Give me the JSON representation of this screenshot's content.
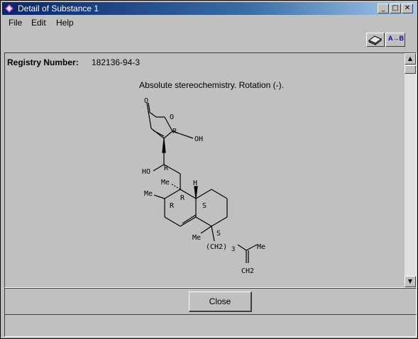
{
  "window": {
    "title": "Detail of Substance 1"
  },
  "titlebar_buttons": {
    "minimize": "_",
    "maximize": "□",
    "close": "✕"
  },
  "menu": [
    "File",
    "Edit",
    "Help"
  ],
  "toolbar": {
    "ab_label": "A→B"
  },
  "content": {
    "registry_label": "Registry Number:",
    "registry_value": "182136-94-3",
    "stereo_note": "Absolute stereochemistry.  Rotation (-)."
  },
  "structure_labels": {
    "o_top": "O",
    "o_ring": "O",
    "oh_right": "OH",
    "r_ring": "R",
    "ho_left": "HO",
    "r_chain": "R",
    "h_top": "H",
    "me_1": "Me",
    "me_2": "Me",
    "r_a": "R",
    "r_b": "R",
    "s_a": "S",
    "s_b": "S",
    "me_3": "Me",
    "ch2_chain": "(CH2)",
    "ch2_sub": "3",
    "me_4": "Me",
    "ch2_end": "CH2"
  },
  "buttons": {
    "close": "Close"
  }
}
